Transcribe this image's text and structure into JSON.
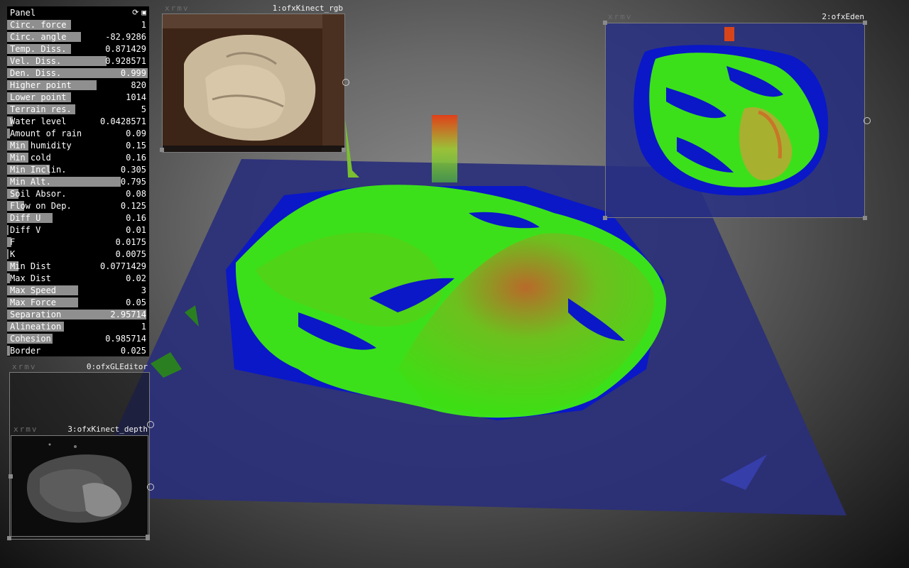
{
  "panel": {
    "title": "Panel",
    "icons": [
      "refresh-icon",
      "save-icon"
    ],
    "rows": [
      {
        "label": "Circ. force",
        "value": "1",
        "fill": 0.45
      },
      {
        "label": "Circ. angle",
        "value": "-82.9286",
        "fill": 0.52
      },
      {
        "label": "Temp. Diss.",
        "value": "0.871429",
        "fill": 0.45
      },
      {
        "label": "Vel. Diss.",
        "value": "0.928571",
        "fill": 0.7
      },
      {
        "label": "Den. Diss.",
        "value": "0.999",
        "fill": 0.99
      },
      {
        "label": "Higher point",
        "value": "820",
        "fill": 0.63
      },
      {
        "label": "Lower point",
        "value": "1014",
        "fill": 0.45
      },
      {
        "label": "Terrain res.",
        "value": "5",
        "fill": 0.48
      },
      {
        "label": "Water level",
        "value": "0.0428571",
        "fill": 0.04
      },
      {
        "label": "Amount of rain",
        "value": "0.09",
        "fill": 0.02
      },
      {
        "label": "Min humidity",
        "value": "0.15",
        "fill": 0.15
      },
      {
        "label": "Min cold",
        "value": "0.16",
        "fill": 0.15
      },
      {
        "label": "Min Inclin.",
        "value": "0.305",
        "fill": 0.3
      },
      {
        "label": "Min Alt.",
        "value": "0.795",
        "fill": 0.8
      },
      {
        "label": "Soil Absor.",
        "value": "0.08",
        "fill": 0.08
      },
      {
        "label": "Flow on Dep.",
        "value": "0.125",
        "fill": 0.12
      },
      {
        "label": "Diff U",
        "value": "0.16",
        "fill": 0.32
      },
      {
        "label": "Diff V",
        "value": "0.01",
        "fill": 0.01
      },
      {
        "label": "F",
        "value": "0.0175",
        "fill": 0.03
      },
      {
        "label": "K",
        "value": "0.0075",
        "fill": 0.01
      },
      {
        "label": "Min Dist",
        "value": "0.0771429",
        "fill": 0.08
      },
      {
        "label": "Max Dist",
        "value": "0.02",
        "fill": 0.02
      },
      {
        "label": "Max Speed",
        "value": "3",
        "fill": 0.5
      },
      {
        "label": "Max Force",
        "value": "0.05",
        "fill": 0.5
      },
      {
        "label": "Separation",
        "value": "2.95714",
        "fill": 0.98
      },
      {
        "label": "Alineation",
        "value": "1",
        "fill": 0.4
      },
      {
        "label": "Cohesion",
        "value": "0.985714",
        "fill": 0.32
      },
      {
        "label": "Border",
        "value": "0.025",
        "fill": 0.02
      }
    ]
  },
  "windows": {
    "kinect_rgb": {
      "controls": "xrmv",
      "title": "1:ofxKinect_rgb"
    },
    "eden": {
      "controls": "xrmv",
      "title": "2:ofxEden"
    },
    "gl_editor": {
      "controls": "xrmv",
      "title": "0:ofxGLEditor"
    },
    "kinect_depth": {
      "controls": "xrmv",
      "title": "3:ofxKinect_depth"
    }
  },
  "colors": {
    "water": "#0a18c8",
    "terrain": "#3ce01a",
    "peak": "#d8441a",
    "plane": "#2a2f7a"
  }
}
